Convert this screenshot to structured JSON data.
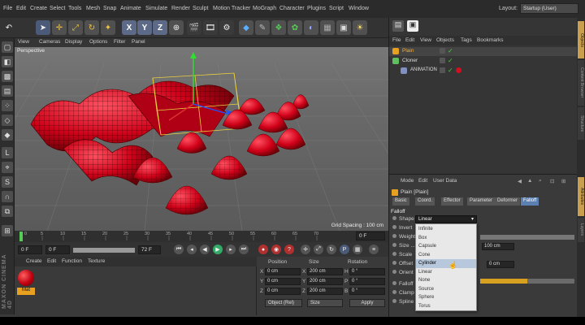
{
  "menubar": {
    "items": [
      "File",
      "Edit",
      "Create",
      "Select",
      "Tools",
      "Mesh",
      "Snap",
      "Animate",
      "Simulate",
      "Render",
      "Sculpt",
      "Motion Tracker",
      "MoGraph",
      "Character",
      "Plugins",
      "Script",
      "Window"
    ],
    "layout_label": "Layout:",
    "layout_value": "Startup (User)"
  },
  "toolbar": {
    "icons": [
      "undo-icon",
      "select-icon",
      "move-icon",
      "scale-icon",
      "rotate-icon",
      "recent-icon",
      "x-axis-icon",
      "y-axis-icon",
      "z-axis-icon",
      "coordinate-system-icon",
      "render-view-icon",
      "render-picture-viewer-icon",
      "render-settings-icon",
      "cube-icon",
      "spline-pen-icon",
      "subdivision-icon",
      "array-icon",
      "deformer-icon",
      "floor-icon",
      "camera-icon",
      "light-icon"
    ],
    "x_label": "X",
    "y_label": "Y",
    "z_label": "Z"
  },
  "viewport": {
    "menu": [
      "View",
      "Cameras",
      "Display",
      "Options",
      "Filter",
      "Panel"
    ],
    "name": "Perspective",
    "grid_spacing": "Grid Spacing : 100 cm"
  },
  "timeline": {
    "ticks": [
      "0",
      "5",
      "10",
      "15",
      "20",
      "25",
      "30",
      "35",
      "40",
      "45",
      "50",
      "55",
      "60",
      "65",
      "70"
    ],
    "end_label": "0 F",
    "current_frame": "0 F",
    "min_frame": "0 F",
    "max_frame": "72 F",
    "end_frame": "72 F"
  },
  "material_manager": {
    "menu": [
      "Create",
      "Edit",
      "Function",
      "Texture"
    ],
    "material_name": "Mat",
    "brand": "MAXON CINEMA 4D",
    "material_color": "#c00010"
  },
  "coordinates": {
    "headers": [
      "Position",
      "Size",
      "Rotation"
    ],
    "rows": [
      {
        "axis": "X",
        "pos": "0 cm",
        "size_axis": "X",
        "size": "200 cm",
        "rot_axis": "H",
        "rot": "0 °"
      },
      {
        "axis": "Y",
        "pos": "0 cm",
        "size_axis": "Y",
        "size": "200 cm",
        "rot_axis": "P",
        "rot": "0 °"
      },
      {
        "axis": "Z",
        "pos": "0 cm",
        "size_axis": "Z",
        "size": "200 cm",
        "rot_axis": "B",
        "rot": "0 °"
      }
    ],
    "mode_select": "Object (Rel)",
    "size_select": "Size",
    "apply_label": "Apply"
  },
  "objects": {
    "menu": [
      "File",
      "Edit",
      "View",
      "Objects",
      "Tags",
      "Bookmarks"
    ],
    "items": [
      {
        "name": "Plain",
        "color": "#e8a020"
      },
      {
        "name": "Cloner",
        "color": "#60c060"
      },
      {
        "name": "ANIMATION",
        "color": "#8090c0"
      }
    ]
  },
  "attributes": {
    "menu": [
      "Mode",
      "Edit",
      "User Data"
    ],
    "title": "Plain [Plain]",
    "tabs": [
      "Basic",
      "Coord.",
      "Effector",
      "Parameter",
      "Deformer",
      "Falloff"
    ],
    "active_tab": "Falloff",
    "section": "Falloff",
    "params": [
      "Shape",
      "Invert",
      "Weight",
      "Size ...",
      "Scale",
      "Offset",
      "Orient",
      "Falloff",
      "Clamp",
      "Spline"
    ],
    "shape_value": "Linear",
    "size_value_1": "100 cm",
    "offset_value": "0 cm",
    "dropdown": [
      "Infinite",
      "Box",
      "Capsule",
      "Cone",
      "Cylinder",
      "Linear",
      "None",
      "Source",
      "Sphere",
      "Torus"
    ],
    "highlighted": "Cylinder"
  },
  "side_tabs": [
    "Objects",
    "Content Browser",
    "Structure",
    "Attributes",
    "Layers"
  ]
}
